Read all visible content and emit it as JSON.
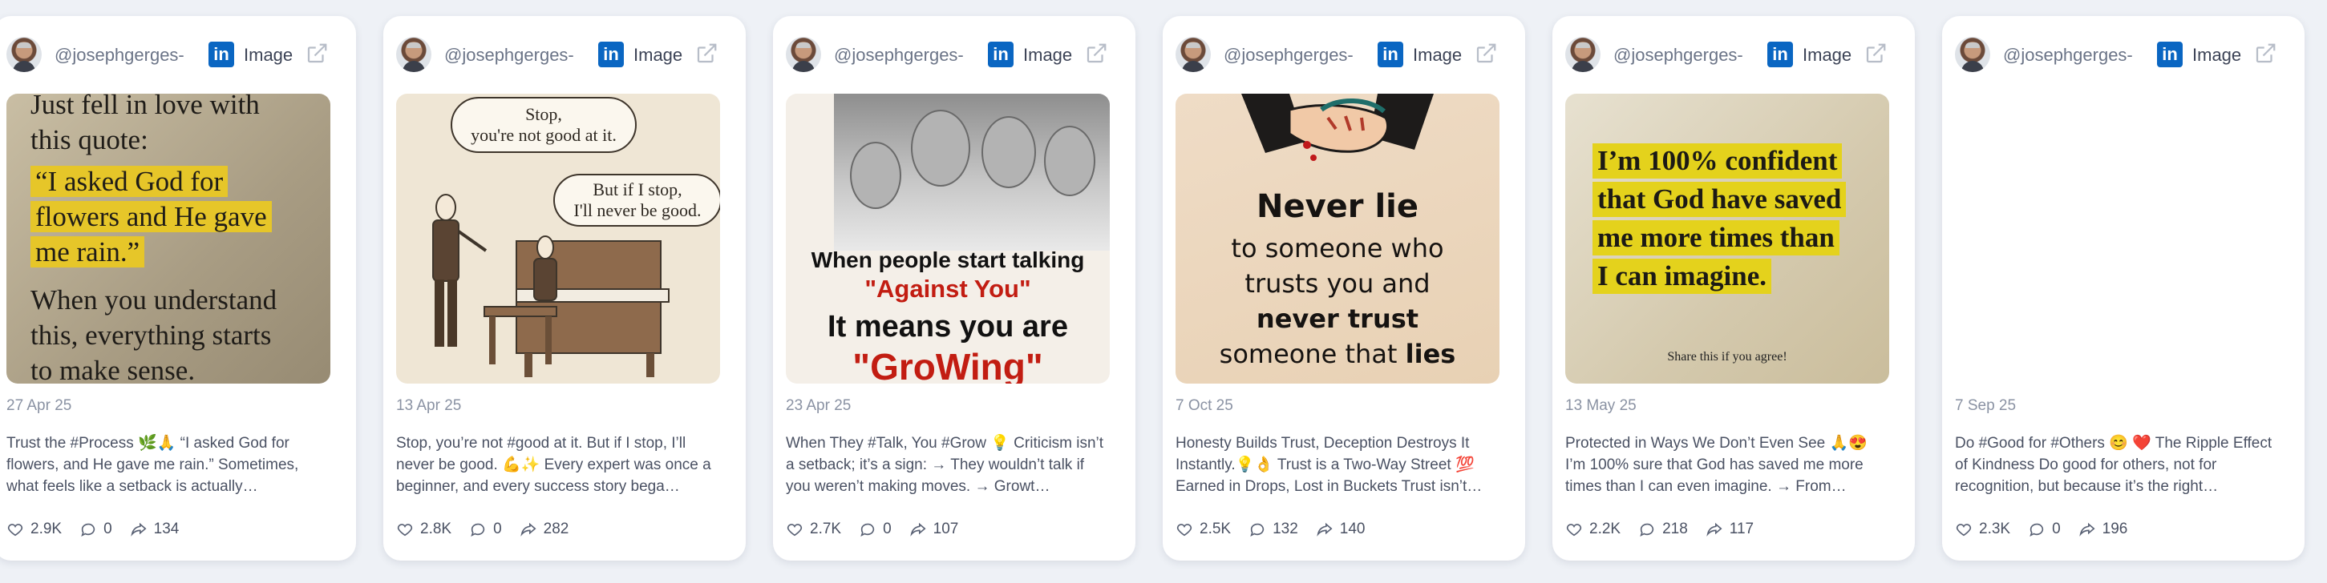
{
  "cards": [
    {
      "handle": "@josephgerges-",
      "type_label": "Image",
      "date": "27 Apr 25",
      "caption": "Trust the #Process 🌿🙏 “I asked God for flowers, and He gave me rain.” Sometimes, what feels like a setback is actually…",
      "likes": "2.9K",
      "comments": "0",
      "shares": "134",
      "media": {
        "line1": "Just fell in love with",
        "line2": "this quote:",
        "quote1": "“I asked God for",
        "quote2": "flowers and He gave",
        "quote3": "me rain.”",
        "line3": "When you understand",
        "line4": "this, everything starts",
        "line5": "to make sense."
      }
    },
    {
      "handle": "@josephgerges-",
      "type_label": "Image",
      "date": "13 Apr 25",
      "caption": "Stop, you’re not #good at it. But if I stop, I’ll never be good. 💪✨ Every expert was once a beginner, and every success story bega…",
      "likes": "2.8K",
      "comments": "0",
      "shares": "282",
      "media": {
        "bubble1a": "Stop,",
        "bubble1b": "you're not good at it.",
        "bubble2a": "But if I stop,",
        "bubble2b": "I'll never be good."
      }
    },
    {
      "handle": "@josephgerges-",
      "type_label": "Image",
      "date": "23 Apr 25",
      "caption": "When They #Talk, You #Grow 💡 Criticism isn’t a setback; it’s a sign: → They wouldn’t talk if you weren’t making moves. → Growt…",
      "likes": "2.7K",
      "comments": "0",
      "shares": "107",
      "media": {
        "line1": "When people start talking",
        "line2": "\"Against You\"",
        "line3": "It means you are",
        "line4": "\"GroWing\""
      }
    },
    {
      "handle": "@josephgerges-",
      "type_label": "Image",
      "date": "7 Oct 25",
      "caption": "Honesty Builds Trust, Deception Destroys It Instantly.💡👌 Trust is a Two-Way Street 💯 Earned in Drops, Lost in Buckets Trust isn’t…",
      "likes": "2.5K",
      "comments": "132",
      "shares": "140",
      "media": {
        "line1": "Never lie",
        "line2": "to someone who",
        "line3": "trusts you and",
        "line4": "never trust",
        "line5a": "someone that ",
        "line5b": "lies"
      }
    },
    {
      "handle": "@josephgerges-",
      "type_label": "Image",
      "date": "13 May 25",
      "caption": "Protected in Ways We Don’t Even See 🙏😍 I’m 100% sure that God has saved me more times than I can even imagine. → From…",
      "likes": "2.2K",
      "comments": "218",
      "shares": "117",
      "media": {
        "line1": "I’m 100% confident",
        "line2": "that God have saved",
        "line3": "me more times than",
        "line4": "I can imagine.",
        "share": "Share this if you agree!"
      }
    },
    {
      "handle": "@josephgerges-",
      "type_label": "Image",
      "date": "7 Sep 25",
      "caption": "Do #Good for #Others 😊 ❤️ The Ripple Effect of Kindness Do good for others, not for recognition, but because it’s the right…",
      "likes": "2.3K",
      "comments": "0",
      "shares": "196"
    }
  ],
  "colors": {
    "background": "#eef1f6",
    "linkedin_blue": "#0a66c2",
    "highlight_yellow": "#e6c629",
    "growing_red": "#c21d12"
  },
  "icons": {
    "linkedin": "linkedin-icon",
    "external": "external-link-icon",
    "likes": "heart-icon",
    "comments": "comment-icon",
    "shares": "share-icon"
  }
}
